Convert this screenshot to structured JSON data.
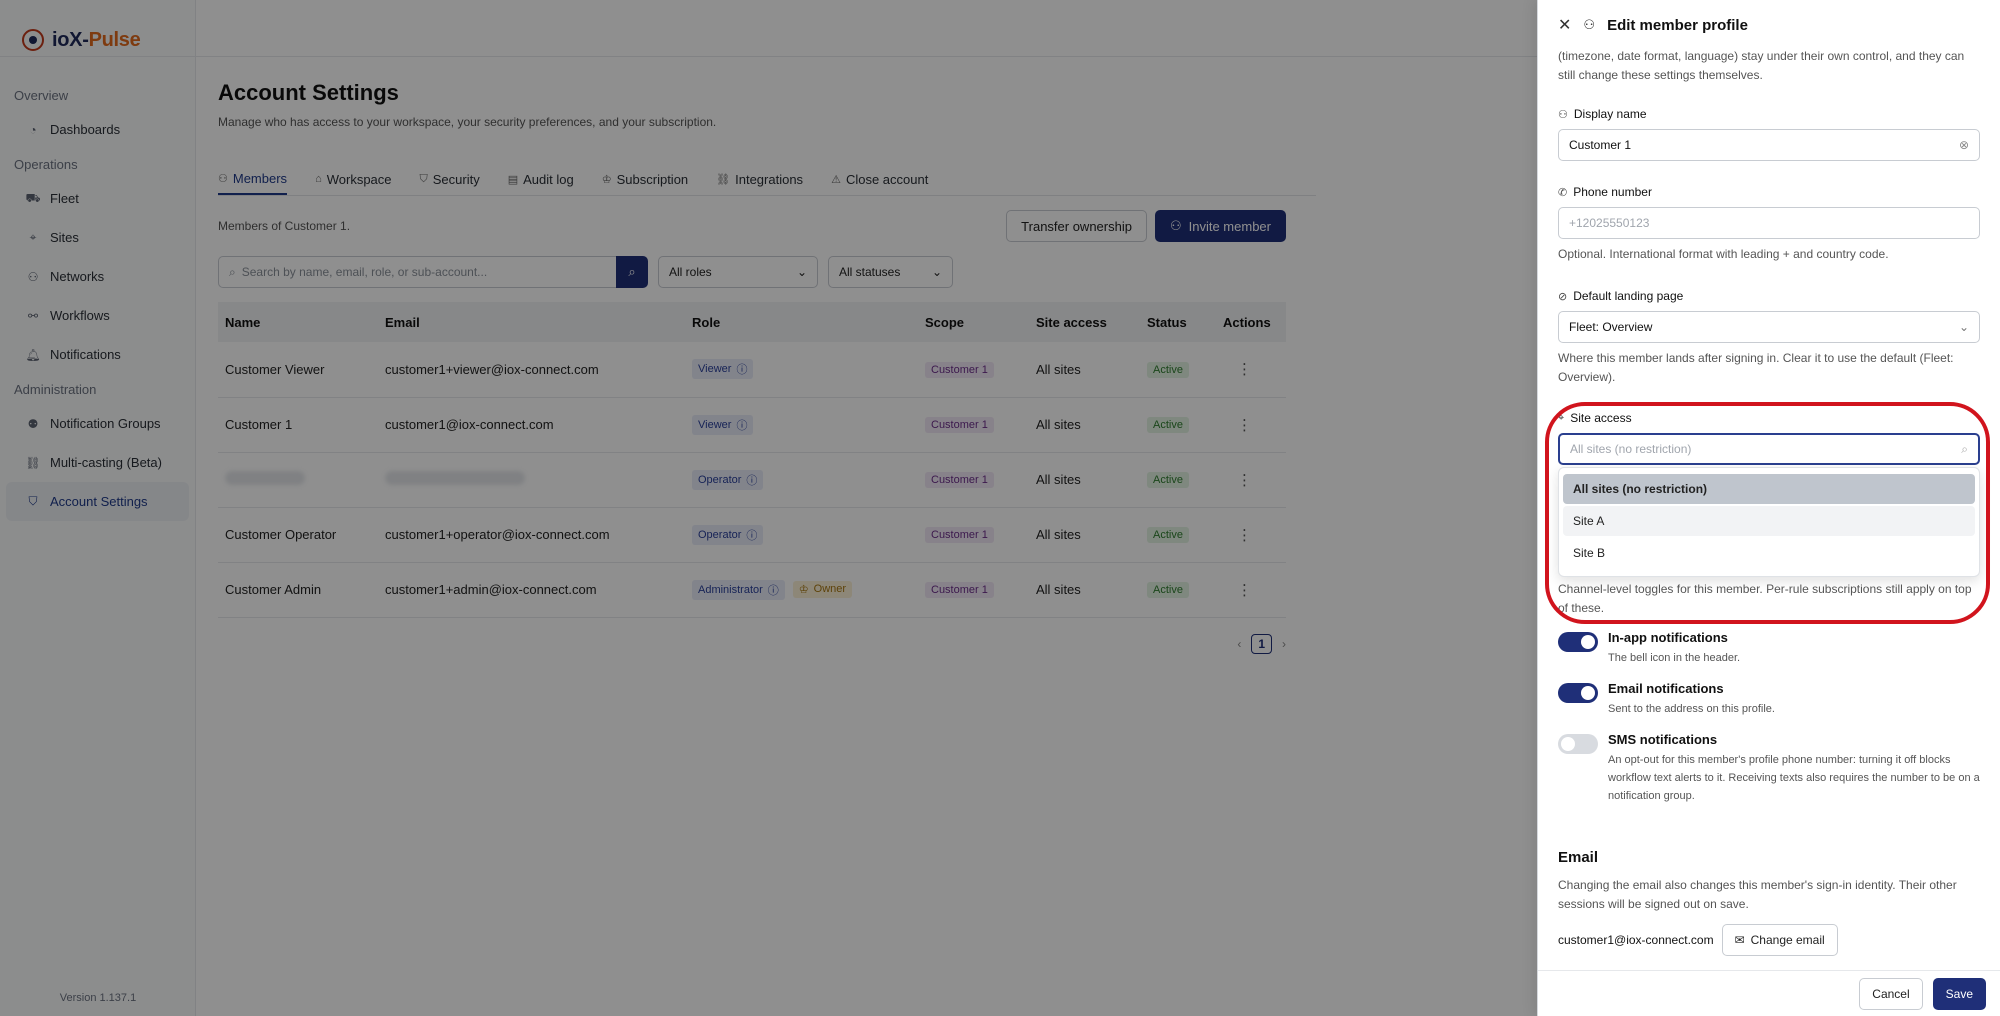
{
  "app": {
    "brand_a": "ioX-",
    "brand_b": "Pulse",
    "version": "Version 1.137.1"
  },
  "sidebar": {
    "sections": [
      {
        "title": "Overview",
        "items": [
          {
            "label": "Dashboards",
            "icon": "dashboard-icon"
          }
        ]
      },
      {
        "title": "Operations",
        "items": [
          {
            "label": "Fleet",
            "icon": "truck-icon"
          },
          {
            "label": "Sites",
            "icon": "pin-icon"
          },
          {
            "label": "Networks",
            "icon": "network-icon"
          },
          {
            "label": "Workflows",
            "icon": "workflow-icon"
          },
          {
            "label": "Notifications",
            "icon": "bell-icon"
          }
        ]
      },
      {
        "title": "Administration",
        "items": [
          {
            "label": "Notification Groups",
            "icon": "users-icon"
          },
          {
            "label": "Multi-casting (Beta)",
            "icon": "link-icon"
          },
          {
            "label": "Account Settings",
            "icon": "shield-icon",
            "active": true
          }
        ]
      }
    ]
  },
  "page": {
    "title": "Account Settings",
    "subtitle": "Manage who has access to your workspace, your security preferences, and your subscription.",
    "tabs": [
      "Members",
      "Workspace",
      "Security",
      "Audit log",
      "Subscription",
      "Integrations",
      "Close account"
    ],
    "members_of": "Members of Customer 1.",
    "transfer_btn": "Transfer ownership",
    "invite_btn": "Invite member",
    "search_placeholder": "Search by name, email, role, or sub-account...",
    "roles_filter": "All roles",
    "status_filter": "All statuses",
    "columns": [
      "Name",
      "Email",
      "Role",
      "Scope",
      "Site access",
      "Status",
      "Actions"
    ],
    "rows": [
      {
        "name": "Customer Viewer",
        "email": "customer1+viewer@iox-connect.com",
        "role": "Viewer",
        "owner": "",
        "scope": "Customer 1",
        "site": "All sites",
        "status": "Active"
      },
      {
        "name": "Customer 1",
        "email": "customer1@iox-connect.com",
        "role": "Viewer",
        "owner": "",
        "scope": "Customer 1",
        "site": "All sites",
        "status": "Active"
      },
      {
        "name": "",
        "email": "",
        "role": "Operator",
        "owner": "",
        "scope": "Customer 1",
        "site": "All sites",
        "status": "Active"
      },
      {
        "name": "Customer Operator",
        "email": "customer1+operator@iox-connect.com",
        "role": "Operator",
        "owner": "",
        "scope": "Customer 1",
        "site": "All sites",
        "status": "Active"
      },
      {
        "name": "Customer Admin",
        "email": "customer1+admin@iox-connect.com",
        "role": "Administrator",
        "owner": "Owner",
        "scope": "Customer 1",
        "site": "All sites",
        "status": "Active"
      }
    ],
    "page_num": "1"
  },
  "drawer": {
    "title": "Edit member profile",
    "intro": "(timezone, date format, language) stay under their own control, and they can still change these settings themselves.",
    "display_name_label": "Display name",
    "display_name_value": "Customer 1",
    "phone_label": "Phone number",
    "phone_placeholder": "+12025550123",
    "phone_help": "Optional. International format with leading + and country code.",
    "landing_label": "Default landing page",
    "landing_value": "Fleet: Overview",
    "landing_help": "Where this member lands after signing in. Clear it to use the default (Fleet: Overview).",
    "site_label": "Site access",
    "site_placeholder": "All sites (no restriction)",
    "site_options": [
      "All sites (no restriction)",
      "Site A",
      "Site B"
    ],
    "channel_help": "Channel-level toggles for this member. Per-rule subscriptions still apply on top of these.",
    "toggles": [
      {
        "title": "In-app notifications",
        "desc": "The bell icon in the header.",
        "on": true
      },
      {
        "title": "Email notifications",
        "desc": "Sent to the address on this profile.",
        "on": true
      },
      {
        "title": "SMS notifications",
        "desc": "An opt-out for this member's profile phone number: turning it off blocks workflow text alerts to it. Receiving texts also requires the number to be on a notification group.",
        "on": false
      }
    ],
    "email_heading": "Email",
    "email_help": "Changing the email also changes this member's sign-in identity. Their other sessions will be signed out on save.",
    "email_value": "customer1@iox-connect.com",
    "change_email_btn": "Change email",
    "cancel_btn": "Cancel",
    "save_btn": "Save"
  },
  "colors": {
    "primary": "#1f2f78",
    "highlight_ring": "#d1141d"
  }
}
